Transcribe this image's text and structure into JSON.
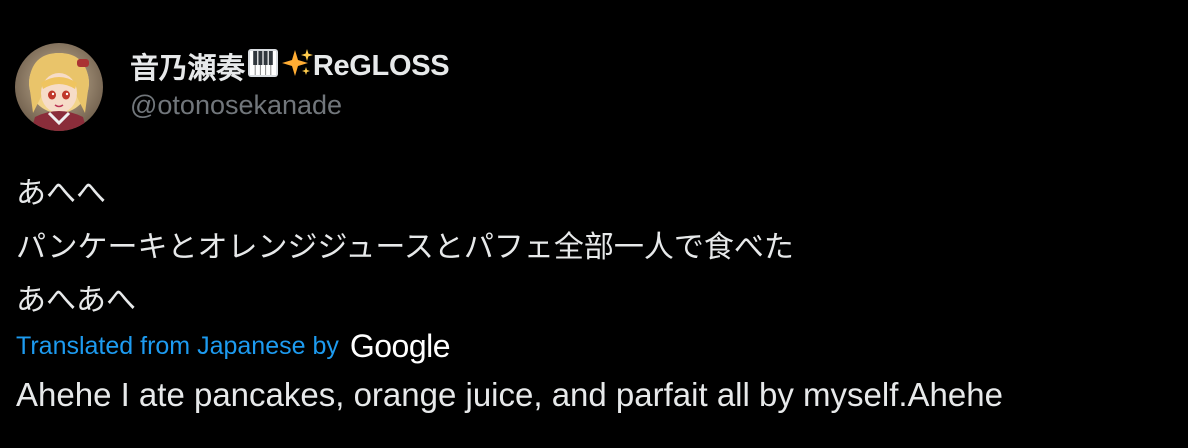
{
  "author": {
    "display_name": "音乃瀬奏",
    "name_suffix": "ReGLOSS",
    "emoji_icons": [
      "piano-keys-icon",
      "sparkles-icon"
    ],
    "handle": "@otonosekanade"
  },
  "tweet": {
    "lines": [
      "あへへ",
      "パンケーキとオレンジジュースとパフェ全部一人で食べた",
      "あへあへ"
    ]
  },
  "translation": {
    "link_label": "Translated from Japanese by",
    "provider": "Google",
    "text": "Ahehe I ate pancakes, orange juice, and parfait all by myself.Ahehe"
  },
  "colors": {
    "background": "#000000",
    "primary_text": "#e7e9ea",
    "secondary_text": "#71767b",
    "link": "#1d9bf0"
  }
}
